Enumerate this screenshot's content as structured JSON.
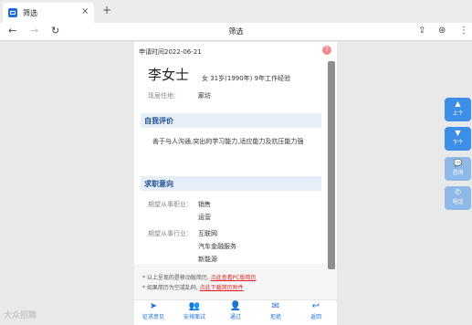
{
  "browser": {
    "tab_title": "筛选",
    "tab_close": "×",
    "new_tab": "+",
    "page_heading": "筛选",
    "icons": [
      "back-icon",
      "forward-icon",
      "refresh-icon",
      "share-icon",
      "extensions-icon",
      "more-icon"
    ]
  },
  "resume": {
    "apply_date": "申请时间2022-06-21",
    "badge": "7",
    "name": "李女士",
    "info": "女  31岁(1990年)  9年工作经验",
    "location_label": "现居住地：",
    "location_value": "廊坊",
    "self_eval_title": "自我评价",
    "self_eval_text": "善于与人沟通,突出的学习能力,适应能力及抗压能力强",
    "intention_title": "求职意向",
    "job_label": "期望从事职业：",
    "jobs": [
      "销售",
      "运营"
    ],
    "industry_label": "期望从事行业：",
    "industries": [
      "互联网",
      "汽车金融服务",
      "新能源"
    ]
  },
  "notes": {
    "note1_prefix": "* 以上呈现的是移动版简历, ",
    "note1_link": "点此查看PC版简历",
    "note2_prefix": "* 如果简历为空或乱码, ",
    "note2_link": "点此下载简历附件"
  },
  "actions": [
    {
      "label": "征求意见",
      "icon": "send-icon"
    },
    {
      "label": "安排面试",
      "icon": "people-icon"
    },
    {
      "label": "通过",
      "icon": "add-user-icon"
    },
    {
      "label": "拒绝",
      "icon": "mail-icon"
    },
    {
      "label": "返回",
      "icon": "return-icon"
    }
  ],
  "side": {
    "up": "上个",
    "down": "下个",
    "consult": "咨询",
    "phone": "电话"
  },
  "watermark": "大众招聘"
}
